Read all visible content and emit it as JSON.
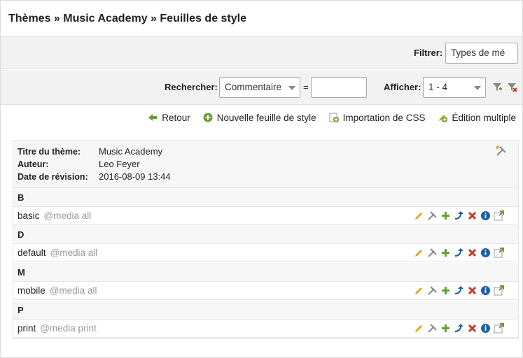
{
  "breadcrumb": "Thèmes » Music Academy » Feuilles de style",
  "filter": {
    "label": "Filtrer:",
    "value": "Types de mé"
  },
  "search": {
    "label": "Rechercher:",
    "field_value": "Commentaire",
    "operator": "=",
    "query": "",
    "show_label": "Afficher:",
    "show_value": "1 - 4"
  },
  "actions": {
    "back": "Retour",
    "new": "Nouvelle feuille de style",
    "import": "Importation de CSS",
    "multi": "Édition multiple"
  },
  "theme": {
    "title_label": "Titre du thème:",
    "title": "Music Academy",
    "author_label": "Auteur:",
    "author": "Leo Feyer",
    "date_label": "Date de révision:",
    "date": "2016-08-09 13:44"
  },
  "groups": [
    {
      "letter": "B",
      "name": "basic",
      "media": "@media all"
    },
    {
      "letter": "D",
      "name": "default",
      "media": "@media all"
    },
    {
      "letter": "M",
      "name": "mobile",
      "media": "@media all"
    },
    {
      "letter": "P",
      "name": "print",
      "media": "@media print"
    }
  ],
  "colors": {
    "accent_green": "#6a9e2c",
    "delete_red": "#c0392b",
    "info_blue": "#1c5fa5",
    "pencil_orange": "#e3a21a"
  }
}
